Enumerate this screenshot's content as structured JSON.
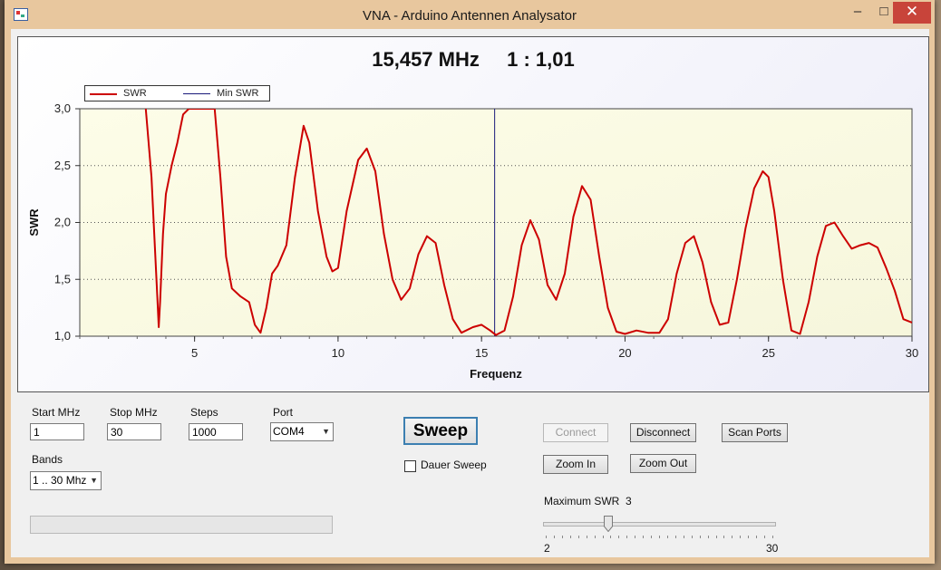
{
  "window": {
    "title": "VNA - Arduino Antennen Analysator",
    "minimize_icon": "minimize-icon",
    "maximize_icon": "maximize-icon",
    "close_icon": "close-icon"
  },
  "readout": {
    "frequency": "15,457 MHz",
    "swr": "1 : 1,01"
  },
  "legend": {
    "swr": "SWR",
    "min_swr": "Min SWR"
  },
  "chart_data": {
    "type": "line",
    "xlabel": "Frequenz",
    "ylabel": "SWR",
    "xlim": [
      1,
      30
    ],
    "ylim": [
      1.0,
      3.0
    ],
    "x_ticks": [
      "5",
      "10",
      "15",
      "20",
      "25",
      "30"
    ],
    "y_ticks": [
      "1,0",
      "1,5",
      "2,0",
      "2,5",
      "3,0"
    ],
    "grid": "dotted horizontal",
    "legend_position": "top-left",
    "min_swr_marker_x": 15.457,
    "series": [
      {
        "name": "SWR",
        "color": "#cc0000",
        "x": [
          3.3,
          3.5,
          3.7,
          3.75,
          3.8,
          3.9,
          4.0,
          4.2,
          4.4,
          4.6,
          4.8,
          5.0,
          5.3,
          5.7,
          5.9,
          6.1,
          6.3,
          6.6,
          6.9,
          7.1,
          7.3,
          7.5,
          7.7,
          7.9,
          8.2,
          8.5,
          8.8,
          9.0,
          9.3,
          9.6,
          9.8,
          10.0,
          10.3,
          10.7,
          11.0,
          11.3,
          11.6,
          11.9,
          12.2,
          12.5,
          12.8,
          13.1,
          13.4,
          13.7,
          14.0,
          14.3,
          14.7,
          15.0,
          15.3,
          15.5,
          15.8,
          16.1,
          16.4,
          16.7,
          17.0,
          17.3,
          17.6,
          17.9,
          18.2,
          18.5,
          18.8,
          19.1,
          19.4,
          19.7,
          20.0,
          20.4,
          20.8,
          21.2,
          21.5,
          21.8,
          22.1,
          22.4,
          22.7,
          23.0,
          23.3,
          23.6,
          23.9,
          24.2,
          24.5,
          24.8,
          25.0,
          25.2,
          25.5,
          25.8,
          26.1,
          26.4,
          26.7,
          27.0,
          27.3,
          27.6,
          27.9,
          28.2,
          28.5,
          28.8,
          29.1,
          29.4,
          29.7,
          30.0
        ],
        "y": [
          3.0,
          2.4,
          1.35,
          1.08,
          1.3,
          1.9,
          2.25,
          2.5,
          2.7,
          2.95,
          3.0,
          3.0,
          3.0,
          3.0,
          2.4,
          1.7,
          1.42,
          1.35,
          1.3,
          1.1,
          1.03,
          1.25,
          1.55,
          1.62,
          1.8,
          2.4,
          2.85,
          2.7,
          2.1,
          1.7,
          1.57,
          1.6,
          2.1,
          2.55,
          2.65,
          2.45,
          1.9,
          1.5,
          1.32,
          1.42,
          1.72,
          1.88,
          1.82,
          1.45,
          1.15,
          1.03,
          1.08,
          1.1,
          1.05,
          1.01,
          1.05,
          1.35,
          1.8,
          2.02,
          1.85,
          1.45,
          1.32,
          1.55,
          2.05,
          2.32,
          2.2,
          1.7,
          1.25,
          1.04,
          1.02,
          1.05,
          1.03,
          1.03,
          1.15,
          1.55,
          1.82,
          1.88,
          1.65,
          1.3,
          1.1,
          1.12,
          1.5,
          1.95,
          2.3,
          2.45,
          2.4,
          2.1,
          1.5,
          1.05,
          1.02,
          1.3,
          1.7,
          1.97,
          2.0,
          1.88,
          1.77,
          1.8,
          1.82,
          1.78,
          1.6,
          1.4,
          1.15,
          1.12
        ]
      },
      {
        "name": "Min SWR",
        "color": "#1a1a7a",
        "x": [
          15.457,
          15.457
        ],
        "y": [
          1.0,
          3.0
        ]
      }
    ]
  },
  "controls": {
    "start_label": "Start MHz",
    "start_value": "1",
    "stop_label": "Stop MHz",
    "stop_value": "30",
    "steps_label": "Steps",
    "steps_value": "1000",
    "port_label": "Port",
    "port_value": "COM4",
    "bands_label": "Bands",
    "bands_value": "1 .. 30 Mhz",
    "sweep": "Sweep",
    "dauer_sweep": "Dauer Sweep",
    "dauer_checked": false,
    "connect": "Connect",
    "disconnect": "Disconnect",
    "scan_ports": "Scan Ports",
    "zoom_in": "Zoom In",
    "zoom_out": "Zoom Out",
    "max_swr_label": "Maximum SWR",
    "max_swr_value": "3",
    "slider_min": "2",
    "slider_max": "30",
    "slider_value": 3,
    "progress": 0
  }
}
